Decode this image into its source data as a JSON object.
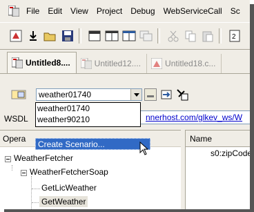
{
  "menu": {
    "items": [
      "File",
      "Edit",
      "View",
      "Project",
      "Debug",
      "WebServiceCall",
      "Sc"
    ]
  },
  "tabs": [
    {
      "label": "Untitled8....",
      "active": true
    },
    {
      "label": "Untitled12....",
      "active": false
    },
    {
      "label": "Untitled18.c...",
      "active": false
    }
  ],
  "scenario": {
    "selected": "weather01740",
    "options": [
      "weather01740",
      "weather90210"
    ]
  },
  "create_scenario": "Create Scenario...",
  "wsdl": {
    "label": "WSDL",
    "url": "nnerhost.com/glkev_ws/W"
  },
  "left_pane": {
    "header": "Opera"
  },
  "tree": {
    "root": "WeatherFetcher",
    "child": "WeatherFetcherSoap",
    "leaves": [
      "GetLicWeather",
      "GetWeather"
    ]
  },
  "right_pane": {
    "header": "Name",
    "cell": "s0:zipCode"
  }
}
